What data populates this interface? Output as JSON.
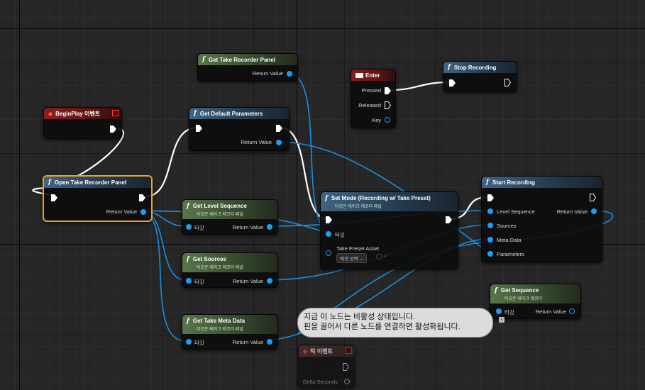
{
  "nodes": {
    "begin_play": {
      "title": "BeginPlay 이벤트"
    },
    "open_panel": {
      "title": "Open Take Recorder Panel",
      "return_label": "Return Value"
    },
    "get_panel": {
      "title": "Get Take Recorder Panel",
      "return_label": "Return Value"
    },
    "get_defaults": {
      "title": "Get Default Parameters",
      "return_label": "Return Value"
    },
    "get_level_seq": {
      "title": "Get Level Sequence",
      "subtitle": "타깃은 테이크 레코더 패널",
      "target_label": "타깃",
      "return_label": "Return Value"
    },
    "get_sources": {
      "title": "Get Sources",
      "subtitle": "타깃은 테이크 레코더 패널",
      "target_label": "타깃",
      "return_label": "Return Value"
    },
    "get_meta": {
      "title": "Get Take Meta Data",
      "subtitle": "타깃은 테이크 레코더 패널",
      "target_label": "타깃",
      "return_label": "Return Value"
    },
    "set_mode": {
      "title": "Set Mode (Recording w/ Take Preset)",
      "subtitle": "타깃은 테이크 레코더 패널",
      "target_label": "타깃",
      "preset_label": "Take Preset Asset",
      "preset_value": "에셋 선택"
    },
    "enter": {
      "title": "Enter",
      "pressed": "Pressed",
      "released": "Released",
      "key": "Key"
    },
    "stop_rec": {
      "title": "Stop Recording"
    },
    "start_rec": {
      "title": "Start Recording",
      "level_seq": "Level Sequence",
      "sources": "Sources",
      "meta": "Meta Data",
      "params": "Parameters",
      "return_label": "Return Value"
    },
    "get_sequence": {
      "title": "Get Sequence",
      "subtitle": "타깃은 테이크 레코더",
      "target_label": "타깃",
      "return_label": "Return Value"
    },
    "tick": {
      "title": "틱 이벤트",
      "delta": "Delta Seconds"
    }
  },
  "tooltip": {
    "line1": "지금 이 노드는 비활성 상태입니다.",
    "line2": "핀을 끌어서 다른 노드를 연결하면 활성화됩니다."
  },
  "colors": {
    "exec": "#ffffff",
    "object_pin": "#1f9cf0",
    "selected": "#f1a226"
  }
}
